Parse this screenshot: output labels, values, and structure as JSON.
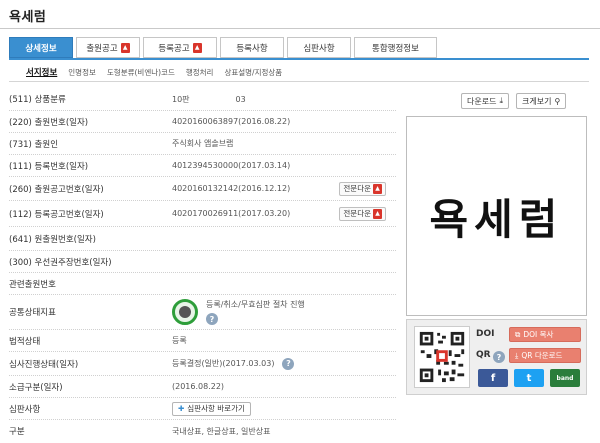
{
  "page": {
    "title": "욕세럼"
  },
  "tabs": [
    {
      "label": "상세정보",
      "active": true,
      "pdf": false
    },
    {
      "label": "출원공고",
      "active": false,
      "pdf": true
    },
    {
      "label": "등록공고",
      "active": false,
      "pdf": true
    },
    {
      "label": "등록사항",
      "active": false,
      "pdf": false
    },
    {
      "label": "심판사항",
      "active": false,
      "pdf": false
    },
    {
      "label": "통합행정정보",
      "active": false,
      "pdf": false
    }
  ],
  "subtabs": [
    "서지정보",
    "인명정보",
    "도형분류(비엔나)코드",
    "행정처리",
    "상표설명/지정상품"
  ],
  "fields": {
    "class": {
      "label": "(511) 상품분류",
      "edition": "10판",
      "code": "03"
    },
    "app_no": {
      "label": "(220) 출원번호(일자)",
      "value": "4020160063897(2016.08.22)"
    },
    "applicant": {
      "label": "(731) 출원인",
      "value": "주식회사 앱솔브랩"
    },
    "reg_no": {
      "label": "(111) 등록번호(일자)",
      "value": "4012394530000(2017.03.14)"
    },
    "pub_app": {
      "label": "(260) 출원공고번호(일자)",
      "value": "4020160132142(2016.12.12)"
    },
    "pub_reg": {
      "label": "(112) 등록공고번호(일자)",
      "value": "4020170026911(2017.03.20)"
    },
    "intl": {
      "label": "(641) 원출원번호(일자)"
    },
    "priority": {
      "label": "(300) 우선권주장번호(일자)"
    },
    "related": {
      "label": "관련출원번호"
    },
    "common": {
      "label": "공통상태지표",
      "value": "등록/취소/무효심판 절차 진행"
    },
    "legal": {
      "label": "법적상태",
      "value": "등록"
    },
    "exam": {
      "label": "심사진행상태(일자)",
      "value": "등록결정(일반)(2017.03.03)"
    },
    "retro": {
      "label": "소급구분(일자)",
      "value": "(2016.08.22)"
    },
    "trial": {
      "label": "심판사항",
      "button": "심판사항 바로가기"
    },
    "kind": {
      "label": "구분",
      "value": "국내상표, 한글상표, 일반상표"
    }
  },
  "buttons": {
    "fulltext": "전문다운",
    "download": "다운로드",
    "zoom": "크게보기"
  },
  "mark": {
    "text": "욕세럼"
  },
  "share": {
    "doi_label": "DOI",
    "qr_label": "QR",
    "doi_button": "DOI 복사",
    "qr_button": "QR 다운로드",
    "social": [
      "f",
      "t",
      "band"
    ]
  },
  "colors": {
    "accent": "#3a8fd0",
    "pdf": "#d9352b",
    "share_button": "#e9806f",
    "facebook": "#3b5998",
    "twitter": "#1da1f2",
    "band": "#2a7d3b"
  }
}
